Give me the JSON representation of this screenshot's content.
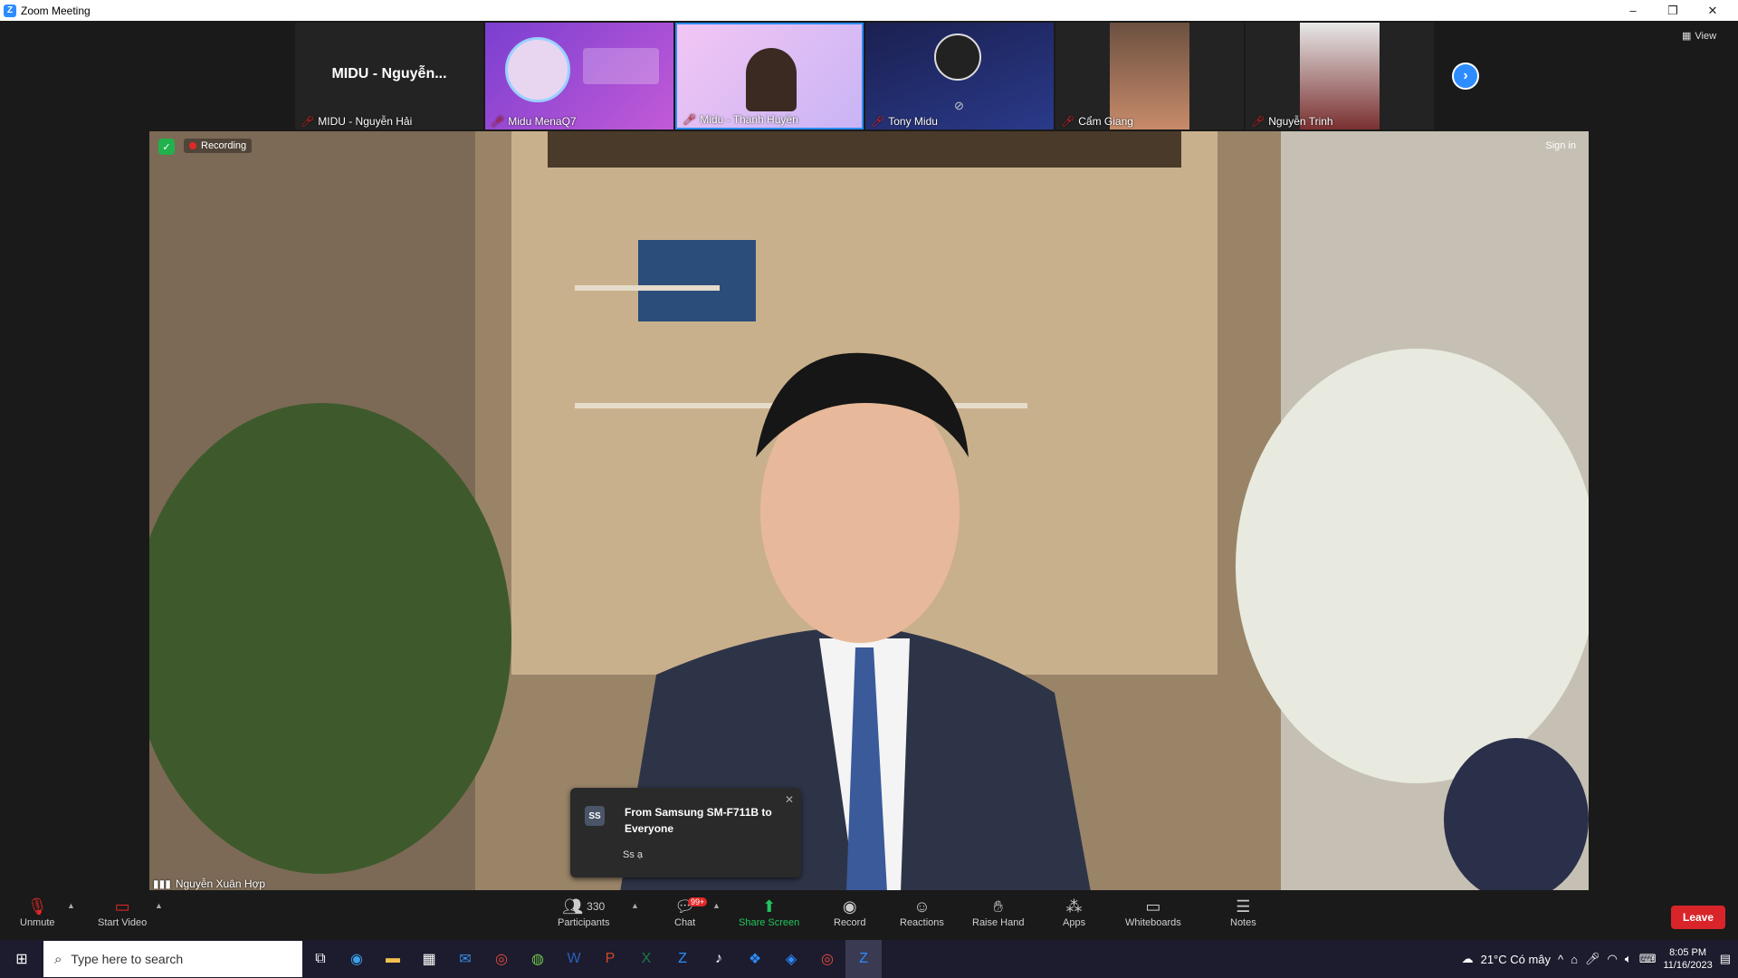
{
  "window": {
    "title": "Zoom Meeting",
    "minimize": "–",
    "restore": "❐",
    "close": "✕"
  },
  "thumbnails": [
    {
      "name": "MIDU - Nguyễn Hải",
      "big_label": "MIDU - Nguyễn...",
      "muted": true
    },
    {
      "name": "Midu MenaQ7",
      "muted": true
    },
    {
      "name": "Midu - Thanh Huyền",
      "muted": true
    },
    {
      "name": "Tony Midu",
      "muted": true
    },
    {
      "name": "Cẩm Giang",
      "muted": true
    },
    {
      "name": "Nguyễn Trinh",
      "muted": true
    }
  ],
  "view_label": "View",
  "main_video": {
    "recording_label": "Recording",
    "sign_in": "Sign in",
    "speaker": "Nguyễn Xuân Hợp"
  },
  "chat_popup": {
    "avatar": "SS",
    "from": "From Samsung SM-F711B to Everyone",
    "message": "Ss ạ"
  },
  "toolbar": {
    "unmute": "Unmute",
    "start_video": "Start Video",
    "participants": "Participants",
    "participants_count": "330",
    "chat": "Chat",
    "chat_badge": "99+",
    "share_screen": "Share Screen",
    "record": "Record",
    "reactions": "Reactions",
    "raise_hand": "Raise Hand",
    "apps": "Apps",
    "whiteboards": "Whiteboards",
    "notes": "Notes",
    "leave": "Leave"
  },
  "taskbar": {
    "search_placeholder": "Type here to search",
    "weather": "21°C  Có mây",
    "time": "8:05 PM",
    "date": "11/16/2023"
  },
  "colors": {
    "accent": "#2d8cff",
    "leave": "#d9252a",
    "share": "#22c55e",
    "muted": "#e02828"
  }
}
